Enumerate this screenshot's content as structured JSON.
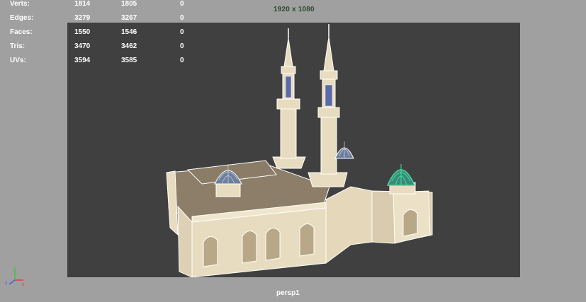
{
  "resolution": "1920 x 1080",
  "camera": "persp1",
  "hud": {
    "rows": [
      {
        "label": "Verts:",
        "v1": "1814",
        "v2": "1805",
        "v3": "0"
      },
      {
        "label": "Edges:",
        "v1": "3279",
        "v2": "3267",
        "v3": "0"
      },
      {
        "label": "Faces:",
        "v1": "1550",
        "v2": "1546",
        "v3": "0"
      },
      {
        "label": "Tris:",
        "v1": "3470",
        "v2": "3462",
        "v3": "0"
      },
      {
        "label": "UVs:",
        "v1": "3594",
        "v2": "3585",
        "v3": "0"
      }
    ]
  },
  "axes": {
    "x": "x",
    "y": "y",
    "z": "z"
  },
  "colors": {
    "viewport_bg": "#a0a0a0",
    "gate_bg": "#404040",
    "wall": "#e8dcc0",
    "roof": "#8c7e68",
    "dome_blue": "#6c7f9c",
    "dome_selected": "#3fe0a0",
    "x_axis": "#e04040",
    "y_axis": "#40c040",
    "z_axis": "#4060e0"
  }
}
